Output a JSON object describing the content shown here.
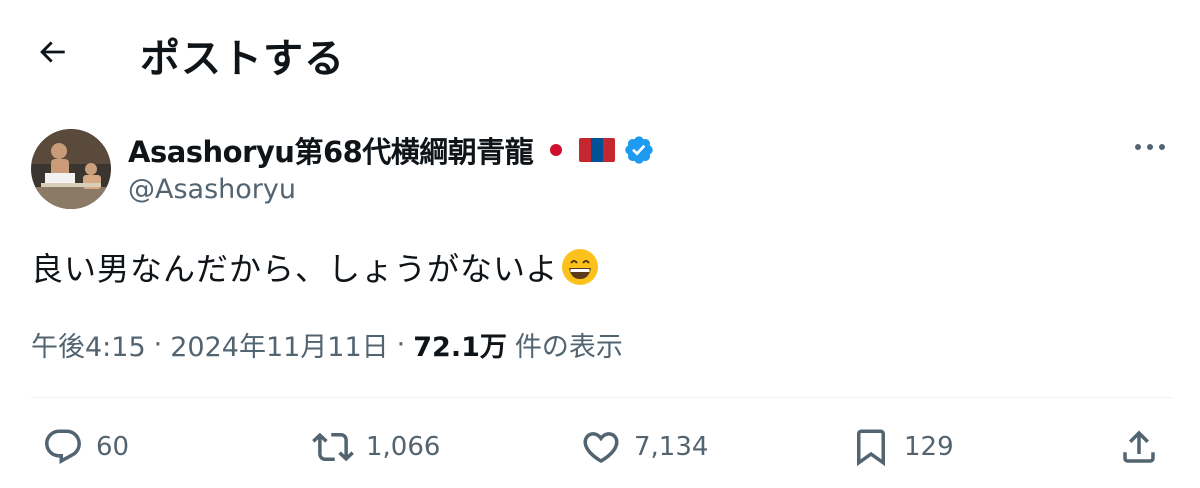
{
  "header": {
    "title": "ポストする",
    "back_icon": "arrow-left-icon"
  },
  "author": {
    "display_name": "Asashoryu第68代横綱朝青龍",
    "handle": "@Asashoryu",
    "flags": [
      "japan-flag-icon",
      "mongolia-flag-icon"
    ],
    "verified_color": "#1d9bf0"
  },
  "post": {
    "text": "良い男なんだから、しょうがないよ",
    "emoji": "grinning-face-icon"
  },
  "meta": {
    "time": "午後4:15",
    "dot1": "·",
    "date": "2024年11月11日",
    "dot2": "·",
    "views": "72.1万",
    "views_label": "件の表示"
  },
  "actions": {
    "replies": "60",
    "reposts": "1,066",
    "likes": "7,134",
    "bookmarks": "129"
  },
  "colors": {
    "text": "#0f1419",
    "secondary": "#536471",
    "accent": "#1d9bf0"
  }
}
